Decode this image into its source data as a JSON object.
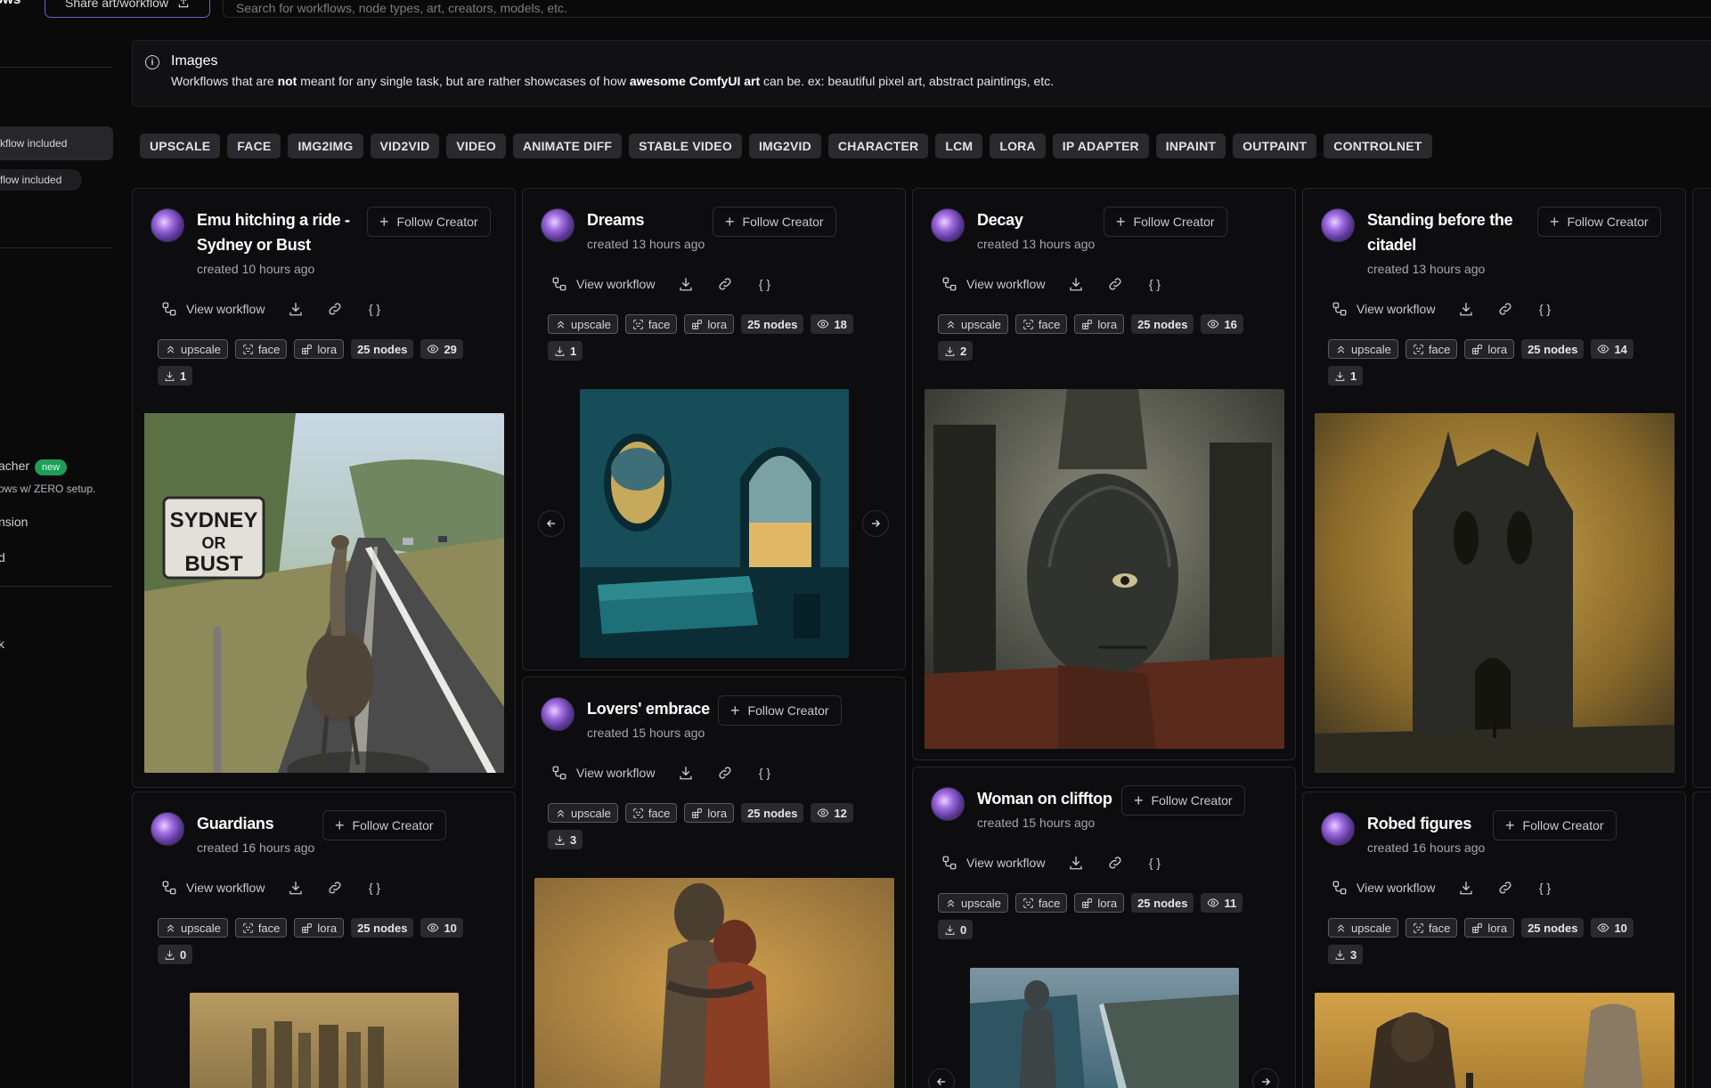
{
  "header": {
    "brand": "ows",
    "share_label": "Share art/workflow",
    "search_placeholder": "Search for workflows, node types, art, creators, models, etc."
  },
  "sidebar": {
    "pill_active": "kflow included",
    "pill_plain": "flow included",
    "launcher_label": "acher",
    "launcher_badge": "new",
    "launcher_sub": "ows w/ ZERO setup.",
    "extension_label": "nsion",
    "d_label": "d",
    "k_label": "k"
  },
  "banner": {
    "title": "Images",
    "desc_1": "Workflows that are ",
    "desc_not": "not",
    "desc_2": " meant for any single task, but are rather showcases of how ",
    "desc_bold": "awesome ComfyUI art",
    "desc_3": " can be. ex: beautiful pixel art, abstract paintings, etc."
  },
  "tags": [
    "UPSCALE",
    "FACE",
    "IMG2IMG",
    "VID2VID",
    "VIDEO",
    "ANIMATE DIFF",
    "STABLE VIDEO",
    "IMG2VID",
    "CHARACTER",
    "LCM",
    "LORA",
    "IP ADAPTER",
    "INPAINT",
    "OUTPAINT",
    "CONTROLNET"
  ],
  "common": {
    "follow": "Follow Creator",
    "view_workflow": "View workflow",
    "chip_upscale": "upscale",
    "chip_face": "face",
    "chip_lora": "lora",
    "chip_nodes": "25 nodes"
  },
  "cards": [
    {
      "title_1": "Emu hitching a ride -",
      "title_2": "Sydney or Bust",
      "created": "created 10 hours ago",
      "views": "29",
      "downloads": "1"
    },
    {
      "title_1": "Dreams",
      "created": "created 13 hours ago",
      "views": "18",
      "downloads": "1"
    },
    {
      "title_1": "Decay",
      "created": "created 13 hours ago",
      "views": "16",
      "downloads": "2"
    },
    {
      "title_1": "Standing before the",
      "title_2": "citadel",
      "created": "created 13 hours ago",
      "views": "14",
      "downloads": "1"
    },
    {
      "title_1": "Guardians",
      "created": "created 16 hours ago",
      "views": "10",
      "downloads": "0"
    },
    {
      "title_1": "Lovers' embrace",
      "created": "created 15 hours ago",
      "views": "12",
      "downloads": "3"
    },
    {
      "title_1": "Woman on clifftop",
      "created": "created 15 hours ago",
      "views": "11",
      "downloads": "0"
    },
    {
      "title_1": "Robed figures",
      "created": "created 16 hours ago",
      "views": "10",
      "downloads": "3"
    }
  ],
  "sign_text": {
    "line1": "SYDNEY",
    "line2": "OR",
    "line3": "BUST"
  },
  "colors": {
    "background": "#0a0a0b",
    "card": "#0d0d0f",
    "chip": "#2a2a2e",
    "new_badge": "#1f9d5b",
    "share_border": "#7d5cc7"
  },
  "icons": [
    "upload-icon",
    "info-icon",
    "plus-icon",
    "workflow-icon",
    "download-icon",
    "link-icon",
    "braces-icon",
    "chevrons-up-icon",
    "face-scan-icon",
    "blocks-icon",
    "eye-icon",
    "arrow-left-icon",
    "arrow-right-icon"
  ]
}
